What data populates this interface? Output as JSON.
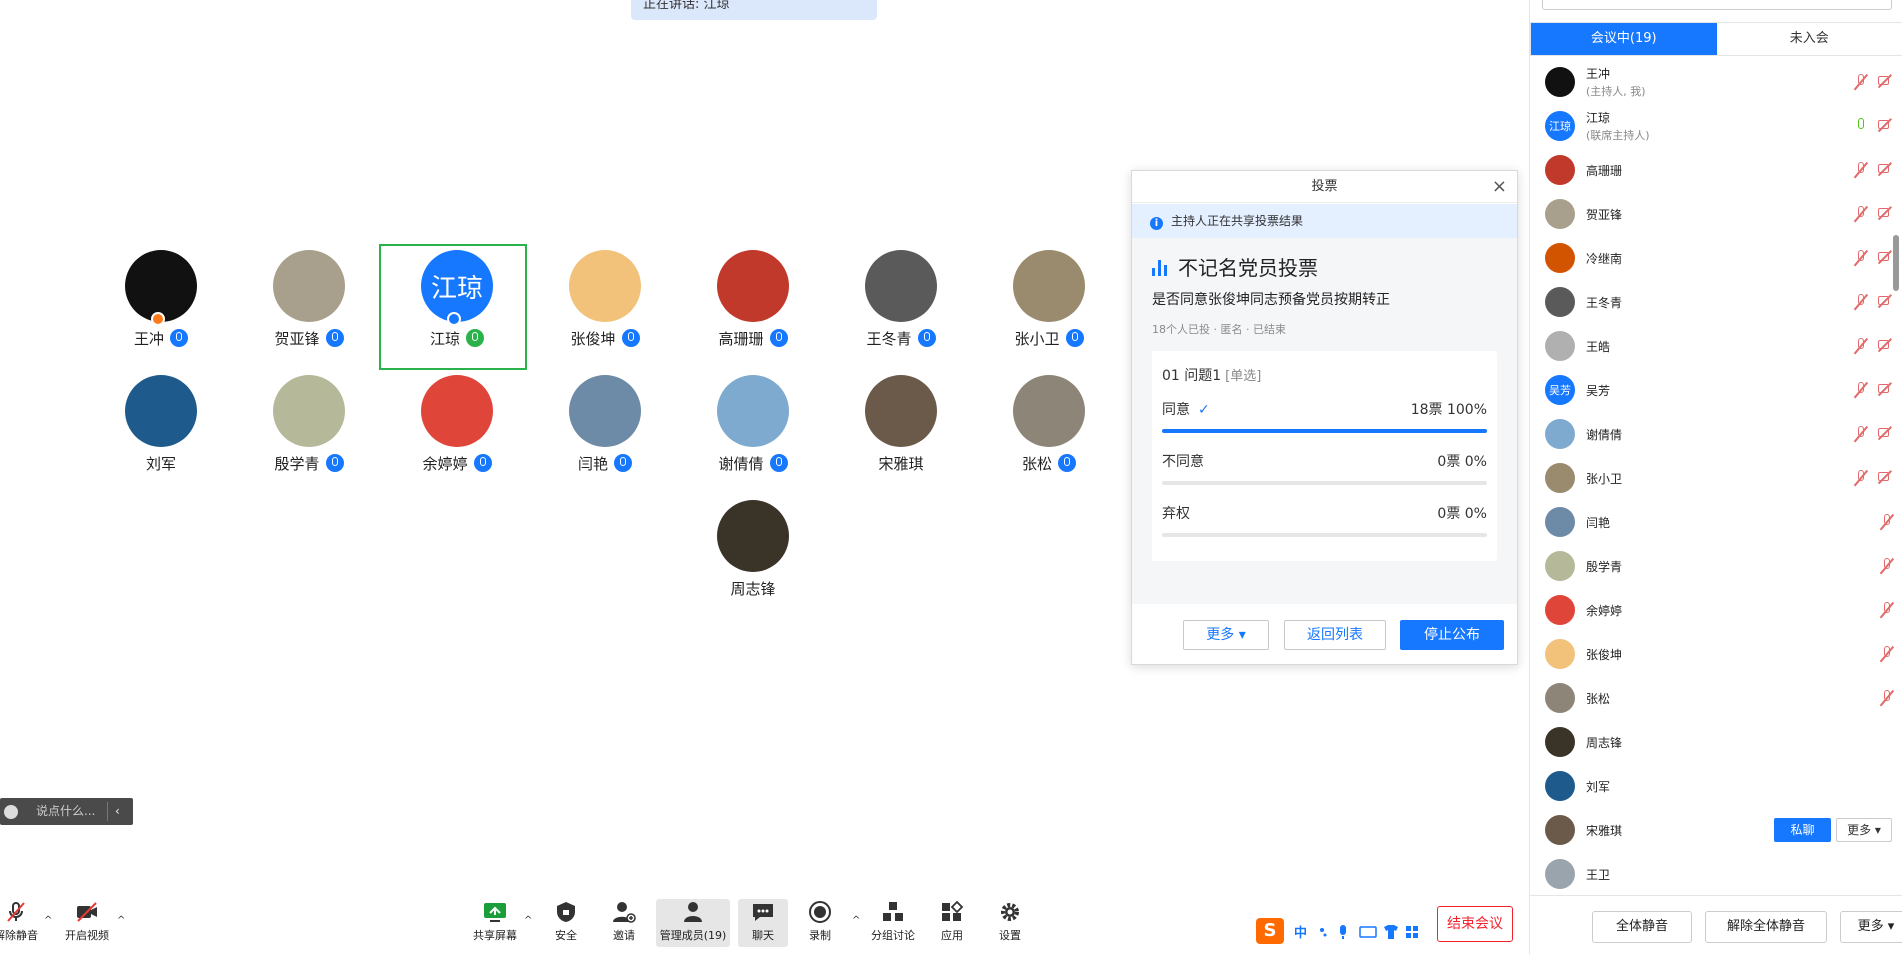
{
  "speaking": {
    "label": "正在讲话: 江琼"
  },
  "gallery": [
    {
      "name": "王冲",
      "initial": "",
      "color": "#111111",
      "mic": "blue",
      "host": true
    },
    {
      "name": "贺亚锋",
      "initial": "",
      "color": "#a89f8c",
      "mic": "blue"
    },
    {
      "name": "江琼",
      "initial": "江琼",
      "color": "#1677ff",
      "mic": "green",
      "active": true,
      "cohost": true
    },
    {
      "name": "张俊坤",
      "initial": "",
      "color": "#f2c27a",
      "mic": "blue"
    },
    {
      "name": "高珊珊",
      "initial": "",
      "color": "#c0392b",
      "mic": "blue"
    },
    {
      "name": "王冬青",
      "initial": "",
      "color": "#5a5a5a",
      "mic": "blue"
    },
    {
      "name": "张小卫",
      "initial": "",
      "color": "#9a8a6e",
      "mic": "blue"
    },
    {
      "name": "刘军",
      "initial": "",
      "color": "#1e5a8c",
      "mic": ""
    },
    {
      "name": "殷学青",
      "initial": "",
      "color": "#b6b89a",
      "mic": "blue"
    },
    {
      "name": "余婷婷",
      "initial": "",
      "color": "#e0453a",
      "mic": "blue"
    },
    {
      "name": "闫艳",
      "initial": "",
      "color": "#6d8aa6",
      "mic": "blue"
    },
    {
      "name": "谢倩倩",
      "initial": "",
      "color": "#7faad0",
      "mic": "blue"
    },
    {
      "name": "宋雅琪",
      "initial": "",
      "color": "#6b5a4a",
      "mic": ""
    },
    {
      "name": "张松",
      "initial": "",
      "color": "#8c8578",
      "mic": "blue"
    },
    {
      "name": "周志锋",
      "initial": "",
      "color": "#3a3328",
      "mic": ""
    }
  ],
  "poll": {
    "title": "投票",
    "close": "×",
    "notice": "主持人正在共享投票结果",
    "name": "不记名党员投票",
    "question": "是否同意张俊坤同志预备党员按期转正",
    "meta": "18个人已投 · 匿名 · 已结束",
    "q_head": "01  问题1",
    "q_type": "[单选]",
    "options": [
      {
        "label": "同意",
        "result": "18票 100%",
        "fraction": 1.0,
        "checked": true
      },
      {
        "label": "不同意",
        "result": "0票 0%",
        "fraction": 0.0
      },
      {
        "label": "弃权",
        "result": "0票 0%",
        "fraction": 0.0
      }
    ],
    "btn_more": "更多 ▾",
    "btn_back": "返回列表",
    "btn_stop": "停止公布"
  },
  "chat": {
    "placeholder": "说点什么...",
    "arrow": "‹"
  },
  "toolbar": {
    "mute": "解除静音",
    "video": "开启视频",
    "share": "共享屏幕",
    "security": "安全",
    "invite": "邀请",
    "members": "管理成员(19)",
    "chat": "聊天",
    "record": "录制",
    "breakout": "分组讨论",
    "apps": "应用",
    "settings": "设置",
    "end": "结束会议",
    "ime_logo": "S",
    "ime_mode": "中"
  },
  "panel": {
    "tab_in": "会议中(19)",
    "tab_out": "未入会",
    "participants": [
      {
        "name": "王冲",
        "role": "(主持人, 我)",
        "color": "#111111",
        "mic": "off",
        "video": true
      },
      {
        "name": "江琼",
        "role": "(联席主持人)",
        "initial": "江琼",
        "color": "#1677ff",
        "mic": "on",
        "video": true
      },
      {
        "name": "高珊珊",
        "color": "#c0392b",
        "mic": "off",
        "video": true
      },
      {
        "name": "贺亚锋",
        "color": "#a89f8c",
        "mic": "off",
        "video": true
      },
      {
        "name": "冷继南",
        "color": "#d35400",
        "mic": "off",
        "video": true
      },
      {
        "name": "王冬青",
        "color": "#5a5a5a",
        "mic": "off",
        "video": true
      },
      {
        "name": "王皓",
        "color": "#b0b0b0",
        "mic": "off",
        "video": true
      },
      {
        "name": "吴芳",
        "initial": "吴芳",
        "color": "#1677ff",
        "mic": "off",
        "video": true
      },
      {
        "name": "谢倩倩",
        "color": "#7faad0",
        "mic": "off",
        "video": true
      },
      {
        "name": "张小卫",
        "color": "#9a8a6e",
        "mic": "off",
        "video": true
      },
      {
        "name": "闫艳",
        "color": "#6d8aa6",
        "mic": "off",
        "video": false
      },
      {
        "name": "殷学青",
        "color": "#b6b89a",
        "mic": "off",
        "video": false
      },
      {
        "name": "余婷婷",
        "color": "#e0453a",
        "mic": "off",
        "video": false
      },
      {
        "name": "张俊坤",
        "color": "#f2c27a",
        "mic": "off",
        "video": false
      },
      {
        "name": "张松",
        "color": "#8c8578",
        "mic": "off",
        "video": false
      },
      {
        "name": "周志锋",
        "color": "#3a3328",
        "mic": "",
        "video": false
      },
      {
        "name": "刘军",
        "color": "#1e5a8c",
        "mic": "",
        "video": false
      },
      {
        "name": "宋雅琪",
        "color": "#6b5a4a",
        "mic": "",
        "video": false,
        "private": "私聊",
        "more": "更多 ▾"
      },
      {
        "name": "王卫",
        "color": "#9aa4ad",
        "mic": "",
        "video": false
      }
    ],
    "mute_all": "全体静音",
    "unmute_all": "解除全体静音",
    "more": "更多 ▾"
  }
}
